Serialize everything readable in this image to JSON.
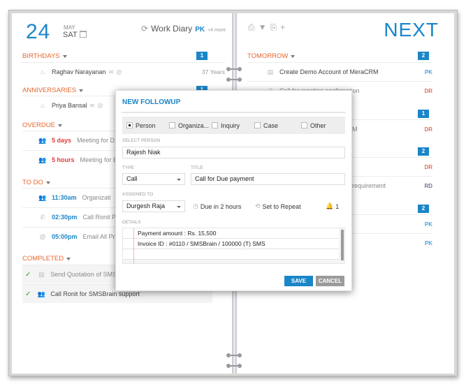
{
  "left": {
    "date": {
      "day_num": "24",
      "month": "MAY",
      "weekday": "SAT"
    },
    "header": {
      "title": "Work Diary",
      "user": "PK",
      "more": "+4 more"
    },
    "sections": {
      "birthdays": {
        "label": "BIRTHDAYS",
        "count": "1",
        "items": [
          {
            "name": "Raghav Narayanan",
            "right": "37 Years"
          }
        ]
      },
      "anniversaries": {
        "label": "ANNIVERSARIES",
        "count": "1",
        "items": [
          {
            "name": "Priya Bansal"
          }
        ]
      },
      "overdue": {
        "label": "OVERDUE",
        "items": [
          {
            "time": "5 days",
            "text": "Meeting for D"
          },
          {
            "time": "5 hours",
            "text": "Meeting for E"
          }
        ]
      },
      "todo": {
        "label": "TO DO",
        "items": [
          {
            "time": "11:30am",
            "text": "Organizati"
          },
          {
            "time": "02:30pm",
            "text": "Call Ronit P"
          },
          {
            "time": "05:00pm",
            "text": "Email All Pr"
          }
        ]
      },
      "completed": {
        "label": "COMPLETED",
        "items": [
          {
            "text": "Send Quotation of SMS"
          },
          {
            "text": "Call Ronit for SMSBrain support"
          }
        ]
      }
    }
  },
  "right": {
    "title": "NEXT",
    "sections": {
      "tomorrow": {
        "label": "TOMORROW",
        "count": "2",
        "items": [
          {
            "text": "Create Demo Account of MeraCRM",
            "initials": "PK"
          },
          {
            "text": "Call for meeting confirmation",
            "initials": "DR"
          }
        ]
      },
      "s2": {
        "count": "1",
        "items": [
          {
            "text": "M",
            "initials": "DR"
          }
        ]
      },
      "s3": {
        "count": "2",
        "items": [
          {
            "text": "",
            "initials": "DR"
          },
          {
            "text": "requirement",
            "initials": "RD"
          }
        ]
      },
      "s4": {
        "count": "2",
        "items": [
          {
            "text": "",
            "initials": "PK"
          },
          {
            "text": "",
            "initials": "PK"
          }
        ]
      }
    }
  },
  "modal": {
    "title": "NEW FOLLOWUP",
    "options": [
      {
        "label": "Person",
        "checked": true
      },
      {
        "label": "Organiza...",
        "checked": false
      },
      {
        "label": "Inquiry",
        "checked": false
      },
      {
        "label": "Case",
        "checked": false
      },
      {
        "label": "Other",
        "checked": false
      }
    ],
    "select_person_label": "SELECT PERSON",
    "person": "Rajesh Niak",
    "type_label": "TYPE",
    "type": "Call",
    "title_label": "TITLE",
    "title_value": "Call for Due payment",
    "assigned_label": "ASSIGNED TO",
    "assigned": "Durgesh Raja",
    "due": "Due in 2 hours",
    "repeat": "Set to Repeat",
    "reminders": "1",
    "details_label": "DETAILS",
    "details_lines": [
      "Payment amount : Rs. 15,500",
      "Invoice ID : #0110 / SMSBrain / 100000 (T) SMS"
    ],
    "save": "SAVE",
    "cancel": "CANCEL"
  }
}
